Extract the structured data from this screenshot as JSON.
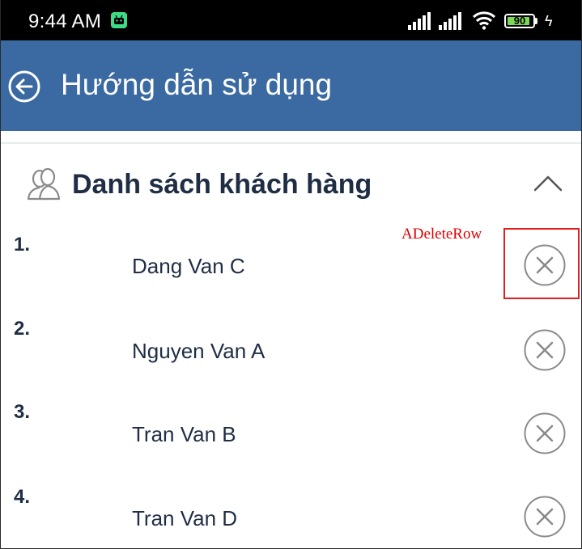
{
  "status_bar": {
    "time": "9:44 AM",
    "battery_level": "90",
    "battery_fraction": 0.9
  },
  "app_bar": {
    "title": "Hướng dẫn sử dụng",
    "back_icon": "back-arrow-circle-icon"
  },
  "section": {
    "title": "Danh sách khách hàng",
    "icon": "people-icon",
    "toggle_icon": "chevron-up-icon"
  },
  "customers": [
    {
      "number": "1.",
      "name": "Dang Van C"
    },
    {
      "number": "2.",
      "name": "Nguyen Van A"
    },
    {
      "number": "3.",
      "name": "Tran Van B"
    },
    {
      "number": "4.",
      "name": "Tran Van D"
    }
  ],
  "annotation": {
    "label": "ADeleteRow",
    "color": "#e00000"
  },
  "colors": {
    "app_bar": "#3b6aa2",
    "text_dark": "#1f2d45",
    "icon_gray": "#8a8a8a"
  }
}
